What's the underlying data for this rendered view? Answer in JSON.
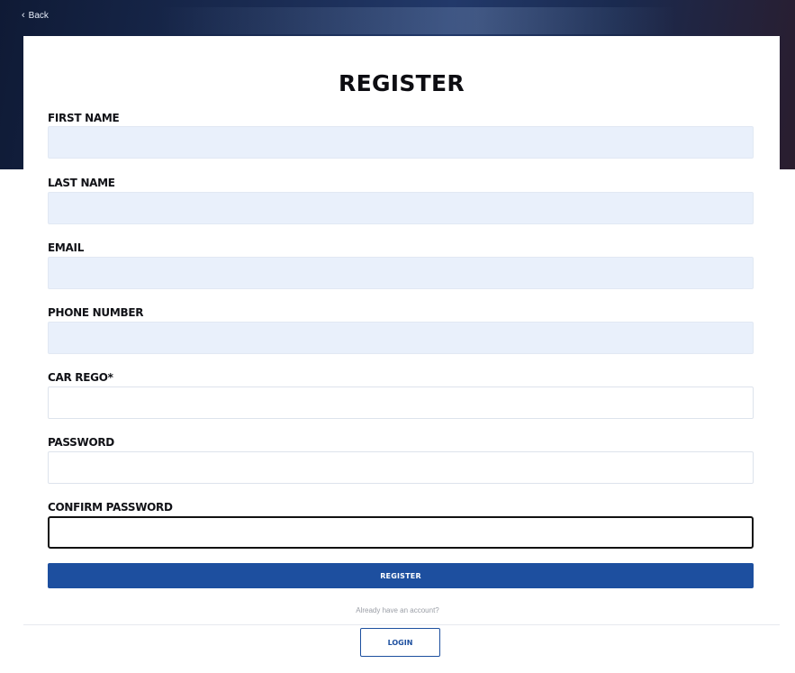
{
  "nav": {
    "back_label": "Back"
  },
  "form": {
    "title": "REGISTER",
    "fields": [
      {
        "label": "FIRST NAME",
        "value": "",
        "state": "autofilled"
      },
      {
        "label": "LAST NAME",
        "value": "",
        "state": "autofilled"
      },
      {
        "label": "EMAIL",
        "value": "",
        "state": "autofilled"
      },
      {
        "label": "PHONE NUMBER",
        "value": "",
        "state": "autofilled"
      },
      {
        "label": "CAR REGO*",
        "value": "",
        "state": "empty"
      },
      {
        "label": "PASSWORD",
        "value": "",
        "state": "empty"
      },
      {
        "label": "CONFIRM PASSWORD",
        "value": "",
        "state": "focused"
      }
    ],
    "submit_label": "REGISTER"
  },
  "footer": {
    "already_text": "Already have an account?",
    "login_label": "LOGIN"
  },
  "colors": {
    "primary": "#1d4f9f",
    "autofill_bg": "#e9f0fb",
    "header_bg": "#1b2d55"
  },
  "icons": {
    "back": "chevron-left-icon"
  }
}
